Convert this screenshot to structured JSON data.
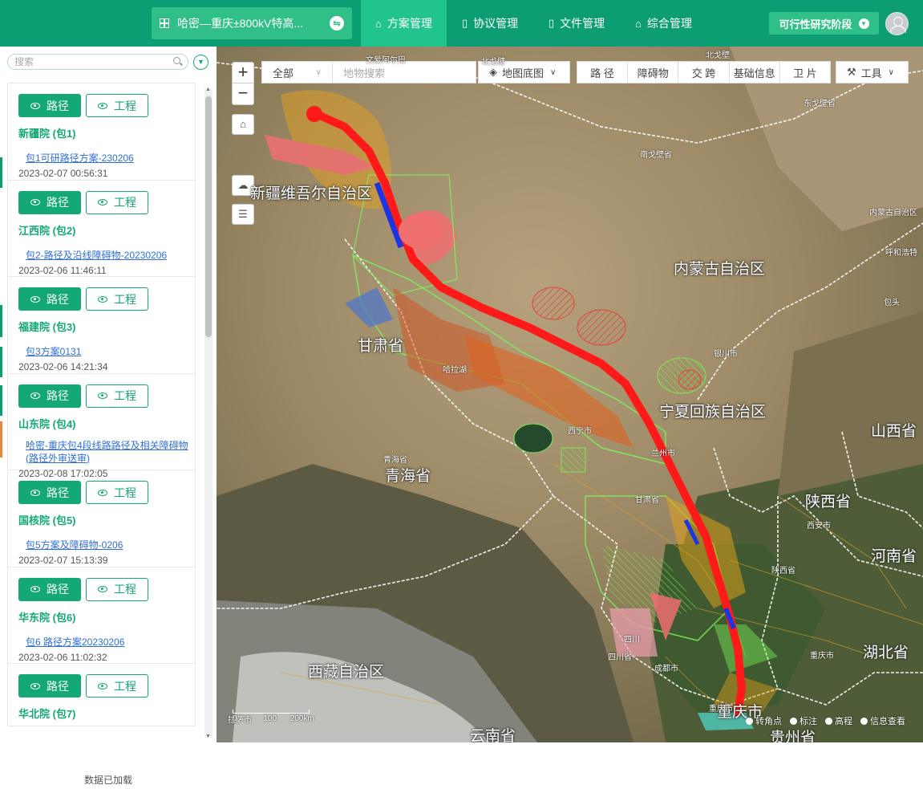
{
  "header": {
    "project_title": "哈密—重庆±800kV特高...",
    "tabs": [
      {
        "label": "方案管理",
        "icon": "home-icon"
      },
      {
        "label": "协议管理",
        "icon": "document-icon"
      },
      {
        "label": "文件管理",
        "icon": "document-icon"
      },
      {
        "label": "综合管理",
        "icon": "home-icon"
      }
    ],
    "stage_label": "可行性研究阶段"
  },
  "sidebar": {
    "search_placeholder": "搜索",
    "route_label": "路径",
    "project_label": "工程",
    "items": [
      {
        "name": "新疆院 (包1)",
        "link": "包1可研路径方案-230206",
        "date": "2023-02-07 00:56:31"
      },
      {
        "name": "江西院 (包2)",
        "link": "包2-路径及沿线障碍物-20230206",
        "date": "2023-02-06 11:46:11"
      },
      {
        "name": "福建院 (包3)",
        "link": "包3方案0131",
        "date": "2023-02-06 14:21:34"
      },
      {
        "name": "山东院 (包4)",
        "link": "哈密-重庆包4段线路路径及相关障碍物(路径外审送审)",
        "date": "2023-02-08 17:02:05"
      },
      {
        "name": "国核院 (包5)",
        "link": "包5方案及障碍物-0206",
        "date": "2023-02-07 15:13:39"
      },
      {
        "name": "华东院 (包6)",
        "link": "包6 路径方案20230206",
        "date": "2023-02-06 11:02:32"
      },
      {
        "name": "华北院 (包7)",
        "link": "",
        "date": ""
      }
    ],
    "status": "数据已加载"
  },
  "map": {
    "filter_value": "全部",
    "search_placeholder": "地物搜索",
    "basemap_label": "地图底图",
    "layer_buttons": [
      "路 径",
      "障碍物",
      "交 跨",
      "基础信息",
      "卫 片"
    ],
    "tools_label": "工具",
    "region_labels": [
      {
        "text": "新疆维吾尔自治区",
        "size": "big"
      },
      {
        "text": "内蒙古自治区",
        "size": "big"
      },
      {
        "text": "甘肃省",
        "size": "big"
      },
      {
        "text": "宁夏回族自治区",
        "size": "big"
      },
      {
        "text": "青海省",
        "size": "big"
      },
      {
        "text": "陕西省",
        "size": "big"
      },
      {
        "text": "山西省",
        "size": "big"
      },
      {
        "text": "河南省",
        "size": "big"
      },
      {
        "text": "湖北省",
        "size": "big"
      },
      {
        "text": "西藏自治区",
        "size": "big"
      },
      {
        "text": "云南省",
        "size": "big"
      },
      {
        "text": "贵州省",
        "size": "big"
      },
      {
        "text": "重庆市",
        "size": "big"
      }
    ],
    "small_labels": [
      "文爱阿尔巴",
      "北戈壁",
      "北戈壁",
      "东戈壁省",
      "南戈壁省",
      "内蒙古自治区",
      "呼和浩特",
      "银川市",
      "西宁市",
      "兰州市",
      "甘肃省",
      "西安市",
      "陕西省",
      "四川省",
      "成都市",
      "重庆市",
      "重庆市",
      "拉萨市",
      "哈拉湖",
      "青海省",
      "包头",
      "四川"
    ],
    "scale": [
      "0",
      "100",
      "200km"
    ],
    "legend": [
      "转角点",
      "标注",
      "高程",
      "信息查看"
    ]
  }
}
